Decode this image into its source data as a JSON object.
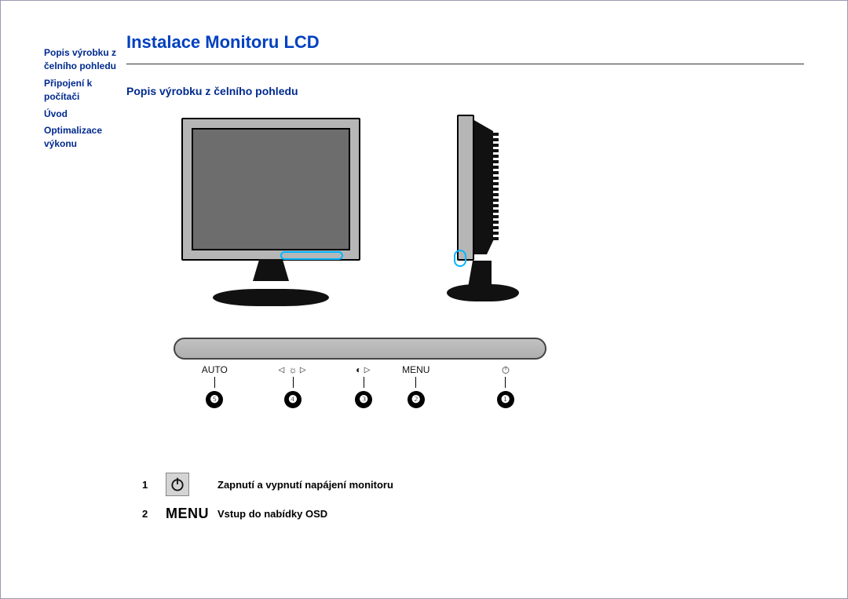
{
  "title": "Instalace Monitoru LCD",
  "subtitle": "Popis výrobku z čelního pohledu",
  "sidebar": {
    "items": [
      {
        "label": "Popis výrobku z čelního pohledu"
      },
      {
        "label": "Připojení k počítači"
      },
      {
        "label": "Úvod"
      },
      {
        "label": "Optimalizace výkonu"
      }
    ]
  },
  "strip": {
    "labels": {
      "auto": "AUTO",
      "menu": "MENU"
    },
    "numbers": {
      "n1": "❶",
      "n2": "❷",
      "n3": "❸",
      "n4": "❹",
      "n5": "❺"
    }
  },
  "functions": [
    {
      "num": "1",
      "icon": "power",
      "desc": "Zapnutí a vypnutí napájení monitoru"
    },
    {
      "num": "2",
      "icon": "menu",
      "label": "MENU",
      "desc": "Vstup do nabídky OSD"
    }
  ]
}
